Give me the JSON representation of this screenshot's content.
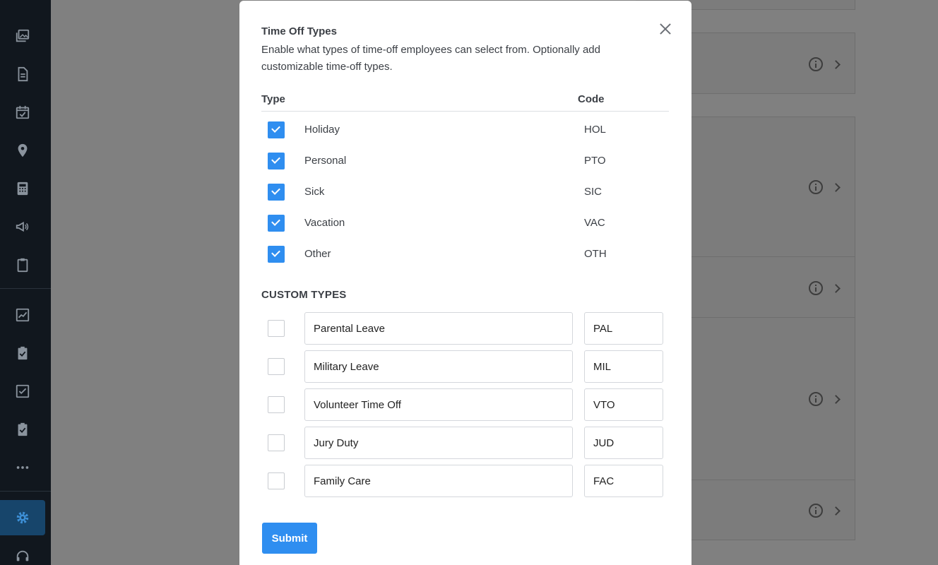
{
  "sidebar": {
    "items": [
      {
        "icon": "image-gallery-icon"
      },
      {
        "icon": "document-icon"
      },
      {
        "icon": "calendar-check-icon"
      },
      {
        "icon": "location-pin-icon"
      },
      {
        "icon": "calculator-icon"
      },
      {
        "icon": "megaphone-icon"
      },
      {
        "icon": "clipboard-icon"
      },
      {
        "icon": "analytics-icon"
      },
      {
        "icon": "clipboard-check-icon"
      },
      {
        "icon": "checkbox-icon"
      },
      {
        "icon": "clipboard-check-icon"
      },
      {
        "icon": "more-dots-icon"
      },
      {
        "icon": "gear-icon",
        "active": true
      },
      {
        "icon": "headset-icon"
      }
    ]
  },
  "modal": {
    "title": "Time Off Types",
    "description": "Enable what types of time-off employees can select from. Optionally add customizable time-off types.",
    "columns": {
      "type": "Type",
      "code": "Code"
    },
    "standard_types": [
      {
        "name": "Holiday",
        "code": "HOL",
        "checked": true
      },
      {
        "name": "Personal",
        "code": "PTO",
        "checked": true
      },
      {
        "name": "Sick",
        "code": "SIC",
        "checked": true
      },
      {
        "name": "Vacation",
        "code": "VAC",
        "checked": true
      },
      {
        "name": "Other",
        "code": "OTH",
        "checked": true
      }
    ],
    "custom_heading": "CUSTOM TYPES",
    "custom_types": [
      {
        "name": "Parental Leave",
        "code": "PAL",
        "checked": false
      },
      {
        "name": "Military Leave",
        "code": "MIL",
        "checked": false
      },
      {
        "name": "Volunteer Time Off",
        "code": "VTO",
        "checked": false
      },
      {
        "name": "Jury Duty",
        "code": "JUD",
        "checked": false
      },
      {
        "name": "Family Care",
        "code": "FAC",
        "checked": false
      }
    ],
    "submit_label": "Submit"
  },
  "colors": {
    "accent": "#2f8ef0",
    "sidebar_bg": "#11171e",
    "sidebar_active": "#17456b",
    "overlay": "#808080"
  }
}
